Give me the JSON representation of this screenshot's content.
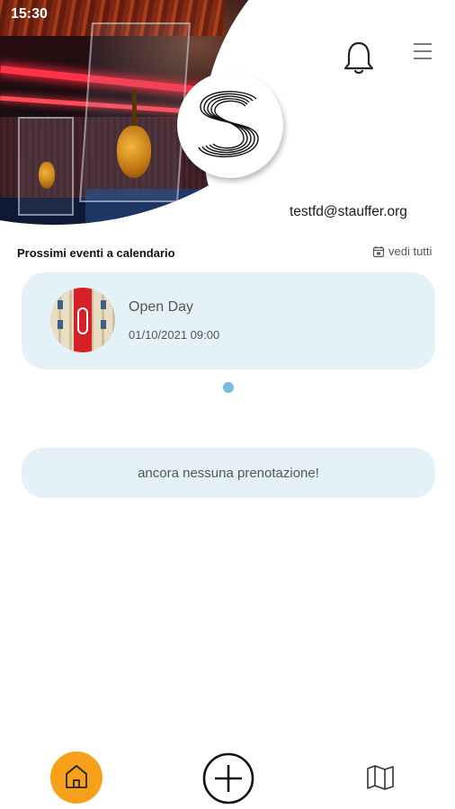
{
  "status_bar": {
    "time": "15:30"
  },
  "header": {
    "logo_letter": "S",
    "user_email": "testfd@stauffer.org",
    "icons": {
      "notifications": "bell-icon",
      "menu": "hamburger-menu-icon"
    }
  },
  "events_section": {
    "title": "Prossimi eventi a calendario",
    "see_all_label": "vedi tutti",
    "see_all_icon": "calendar-icon",
    "events": [
      {
        "title": "Open Day",
        "datetime": "01/10/2021 09:00"
      }
    ],
    "carousel": {
      "pages": 1,
      "active_page": 1
    }
  },
  "bookings": {
    "empty_message": "ancora nessuna prenotazione!"
  },
  "bottom_nav": {
    "items": [
      {
        "icon": "home-icon",
        "active": true,
        "color": "#f7a11a"
      },
      {
        "icon": "plus-circle-icon",
        "active": false
      },
      {
        "icon": "map-icon",
        "active": false
      }
    ]
  },
  "colors": {
    "card_bg": "#e4f2f7",
    "accent": "#f7a11a",
    "dot": "#78bcd9"
  }
}
